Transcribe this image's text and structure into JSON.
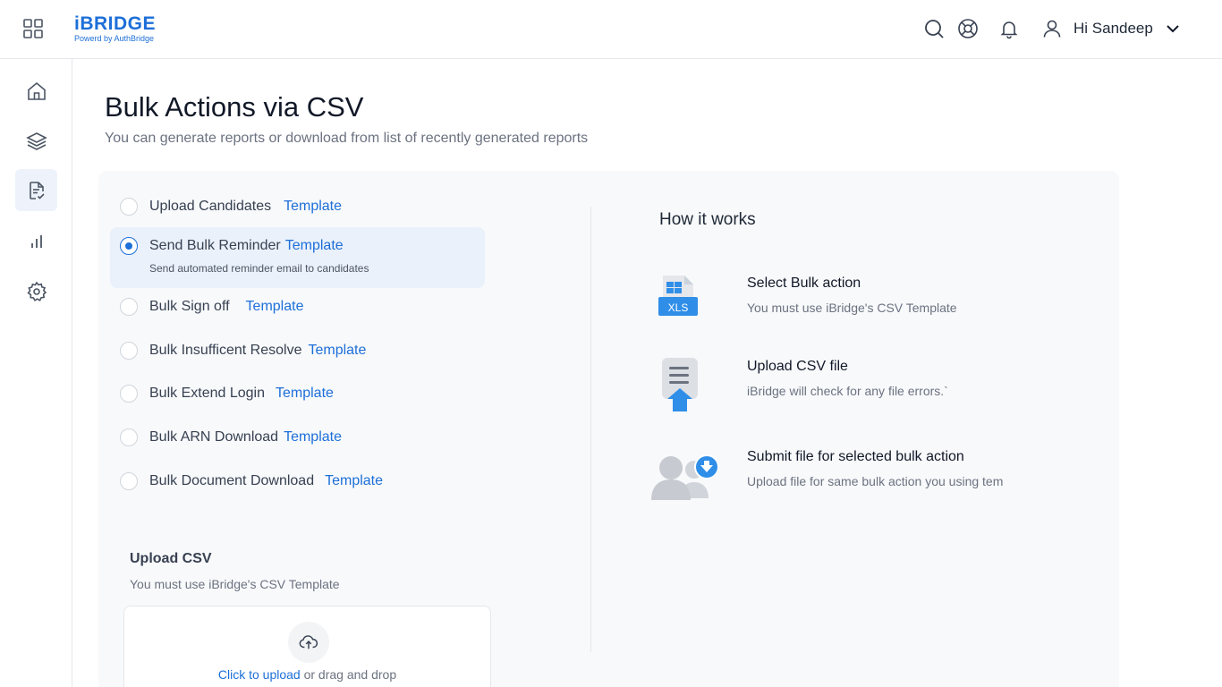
{
  "header": {
    "logo_title": "iBRIDGE",
    "logo_subtitle": "Powerd by AuthBridge",
    "user_greeting": "Hi Sandeep"
  },
  "page": {
    "title": "Bulk Actions via CSV",
    "subtitle": "You can generate reports or download from list of recently generated reports"
  },
  "options": [
    {
      "label": "Upload Candidates",
      "link": "Template",
      "selected": false
    },
    {
      "label": "Send Bulk Reminder",
      "link": "Template",
      "selected": true,
      "description": "Send automated reminder email to candidates"
    },
    {
      "label": "Bulk Sign off",
      "link": "Template",
      "selected": false
    },
    {
      "label": "Bulk Insufficent Resolve",
      "link": "Template",
      "selected": false
    },
    {
      "label": "Bulk Extend Login",
      "link": "Template",
      "selected": false
    },
    {
      "label": "Bulk ARN Download",
      "link": "Template",
      "selected": false
    },
    {
      "label": "Bulk Document Download",
      "link": "Template",
      "selected": false
    }
  ],
  "how_it_works": {
    "title": "How it works",
    "steps": [
      {
        "title": "Select Bulk action",
        "desc": "You must use iBridge's CSV Template",
        "icon": "xls-file-icon",
        "badge": "XLS"
      },
      {
        "title": "Upload CSV file",
        "desc": "iBridge will check for any file errors.`",
        "icon": "upload-document-icon"
      },
      {
        "title": "Submit  file for selected bulk action",
        "desc": "Upload file for same bulk action you using tem",
        "icon": "users-submit-icon"
      }
    ]
  },
  "upload": {
    "title": "Upload CSV",
    "subtitle": "You must use iBridge's CSV Template",
    "click_text": "Click to upload",
    "drag_text": " or drag and drop"
  },
  "colors": {
    "accent": "#1d6fd8",
    "selected_bg": "#eaf1fb",
    "panel_bg": "#f8f9fb"
  }
}
